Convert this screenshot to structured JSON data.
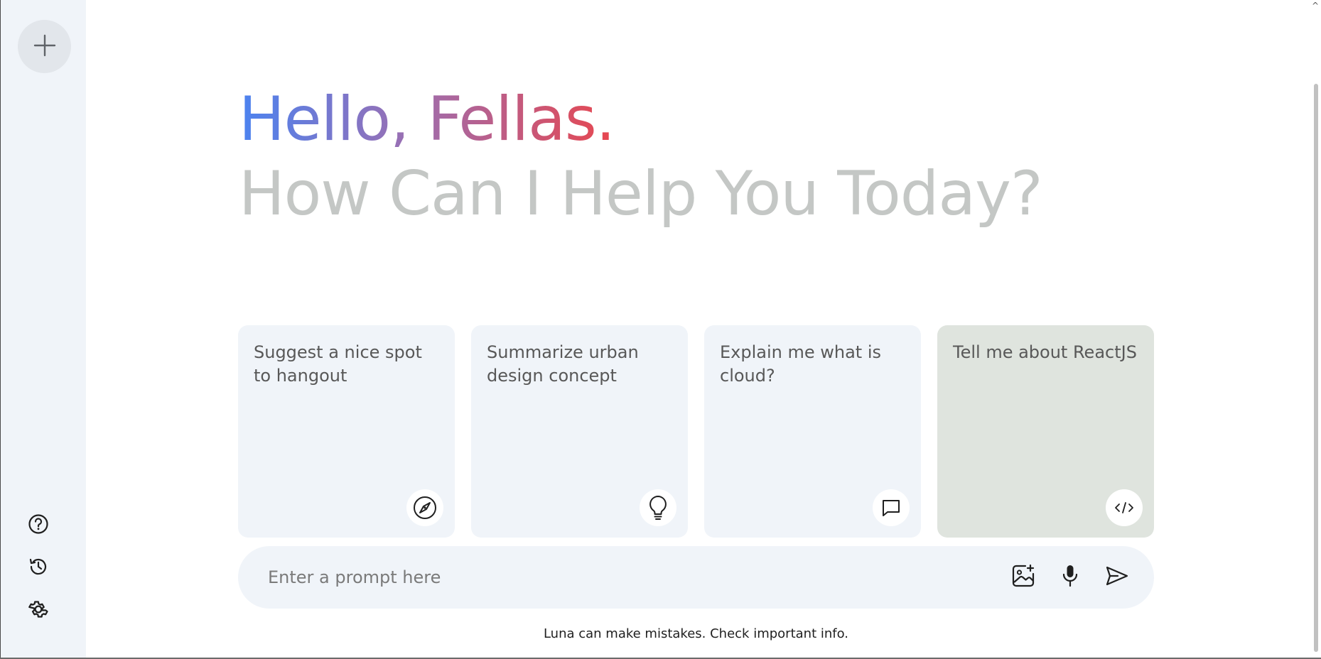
{
  "sidebar": {
    "new_chat_icon": "plus-icon",
    "bottom_icons": [
      "help-icon",
      "history-icon",
      "settings-icon"
    ]
  },
  "greeting": {
    "hello": "Hello, Fellas.",
    "subtitle": "How Can I Help You Today?"
  },
  "cards": [
    {
      "text": "Suggest a nice spot to hangout",
      "icon": "compass-icon"
    },
    {
      "text": "Summarize urban design concept",
      "icon": "bulb-icon"
    },
    {
      "text": "Explain me what is cloud?",
      "icon": "message-icon"
    },
    {
      "text": "Tell me about ReactJS",
      "icon": "code-icon"
    }
  ],
  "prompt": {
    "placeholder": "Enter a prompt here",
    "value": ""
  },
  "disclaimer": "Luna can make mistakes. Check important info.",
  "colors": {
    "sidebar_bg": "#f0f4f9",
    "card_bg": "#f0f4f9",
    "card_active_bg": "#dfe4de",
    "subtitle": "#c4c7c5",
    "gradient_start": "#4b83f0",
    "gradient_end": "#e8474f"
  }
}
